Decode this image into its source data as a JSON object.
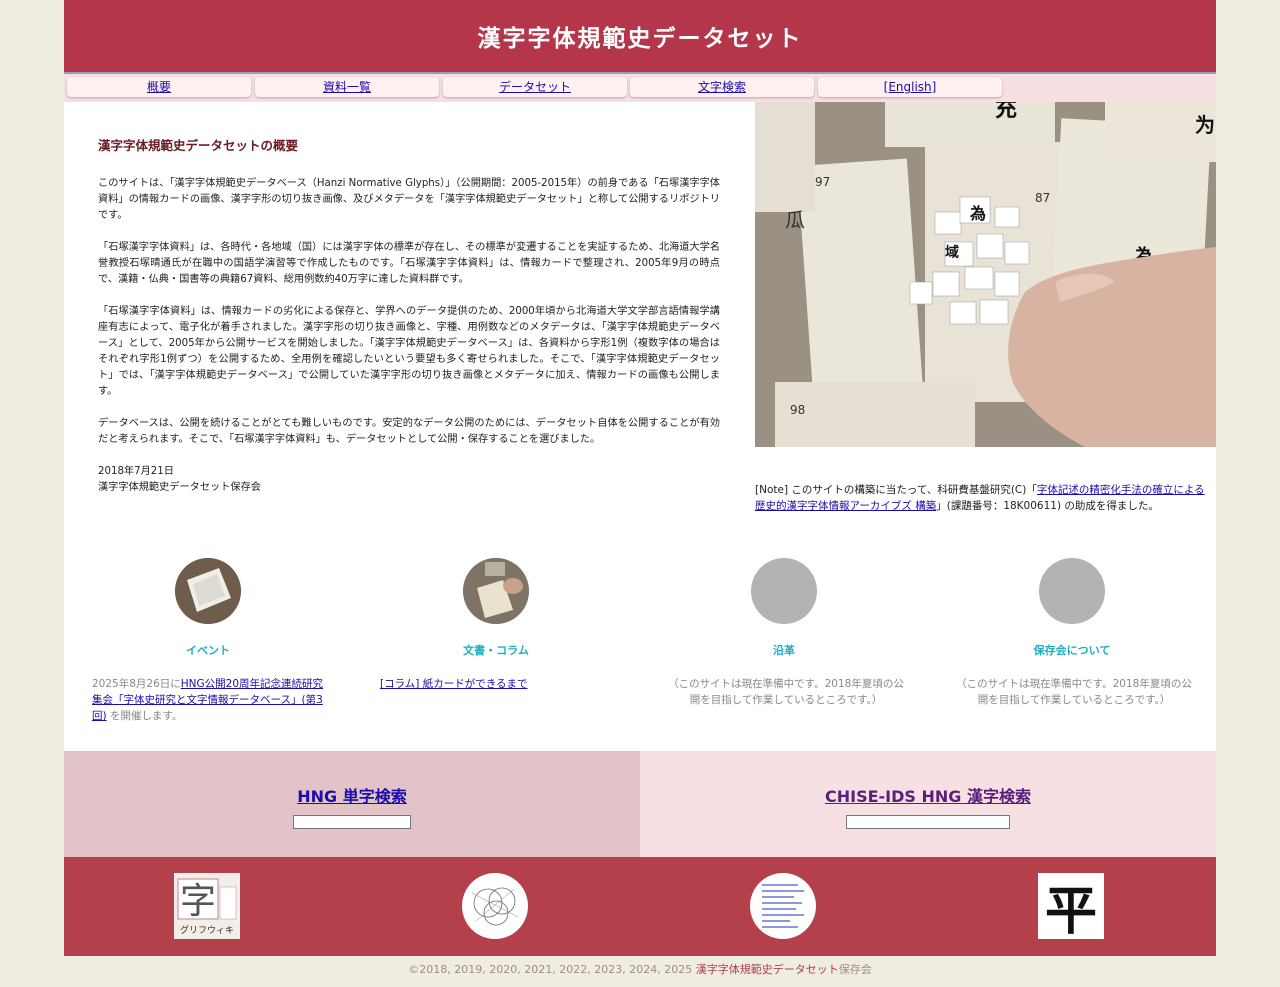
{
  "site_title": "漢字字体規範史データセット",
  "nav": [
    "概要",
    "資料一覧",
    "データセット",
    "文字検索",
    "[English]"
  ],
  "overview": {
    "heading": "漢字字体規範史データセットの概要",
    "paragraphs": [
      "このサイトは、「漢字字体規範史データベース（Hanzi Normative Glyphs）」（公開期間：2005-2015年）の前身である「石塚漢字字体資料」の情報カードの画像、漢字字形の切り抜き画像、及びメタデータを「漢字字体規範史データセット」と称して公開するリポジトリです。",
      "「石塚漢字字体資料」は、各時代・各地域（国）には漢字字体の標準が存在し、その標準が変遷することを実証するため、北海道大学名誉教授石塚晴通氏が在職中の国語学演習等で作成したものです。「石塚漢字字体資料」は、情報カードで整理され、2005年9月の時点で、漢籍・仏典・国書等の典籍67資料、総用例数約40万字に達した資料群です。",
      "「石塚漢字字体資料」は、情報カードの劣化による保存と、学界へのデータ提供のため、2000年頃から北海道大学文学部言語情報学講座有志によって、電子化が着手されました。漢字字形の切り抜き画像と、字種、用例数などのメタデータは、「漢字字体規範史データベース」として、2005年から公開サービスを開始しました。「漢字字体規範史データベース」は、各資料から字形1例（複数字体の場合はそれぞれ字形1例ずつ）を公開するため、全用例を確認したいという要望も多く寄せられました。そこで、「漢字字体規範史データセット」では、「漢字字体規範史データベース」で公開していた漢字字形の切り抜き画像とメタデータに加え、情報カードの画像も公開します。",
      "データベースは、公開を続けることがとても難しいものです。安定的なデータ公開のためには、データセット自体を公開することが有効だと考えられます。そこで、「石塚漢字字体資料」も、データセットとして公開・保存することを選びました。"
    ],
    "date": "2018年7月21日",
    "org": "漢字字体規範史データセット保存会"
  },
  "note": {
    "prefix": "[Note] このサイトの構築に当たって、科研費基盤研究(C)「",
    "link": "字体記述の精密化手法の確立による歴史的漢字字体情報アーカイブズ 構築",
    "suffix": "」(課題番号：18K00611) の助成を得ました。"
  },
  "cards": [
    {
      "title": "イベント",
      "desc_prefix": "2025年8月26日に",
      "desc_link": "HNG公開20周年記念連続研究集会「字体史研究と文字情報データベース」(第3回)",
      "desc_suffix": " を開催します。"
    },
    {
      "title": "文書・コラム",
      "desc_link": "[コラム] 紙カードができるまで"
    },
    {
      "title": "沿革",
      "desc": "（このサイトは現在準備中です。2018年夏頃の公開を目指して作業しているところです。）"
    },
    {
      "title": "保存会について",
      "desc": "（このサイトは現在準備中です。2018年夏頃の公開を目指して作業しているところです。）"
    }
  ],
  "search": {
    "left_label": "HNG 単字検索",
    "right_label": "CHISE-IDS HNG 漢字検索",
    "left_value": "",
    "right_value": ""
  },
  "footer_icons": {
    "glyphwiki_char": "字",
    "glyphwiki_name": "グリフウィキ",
    "hei_char": "平"
  },
  "copyright": {
    "years": "©2018, 2019, 2020, 2021, 2022, 2023, 2024, 2025 ",
    "org": "漢字字体規範史データセット",
    "suffix": "保存会"
  },
  "colors": {
    "header": "#b3364a",
    "footer": "#b3404b",
    "card_title": "#1faec0",
    "link": "#1a0dab"
  }
}
